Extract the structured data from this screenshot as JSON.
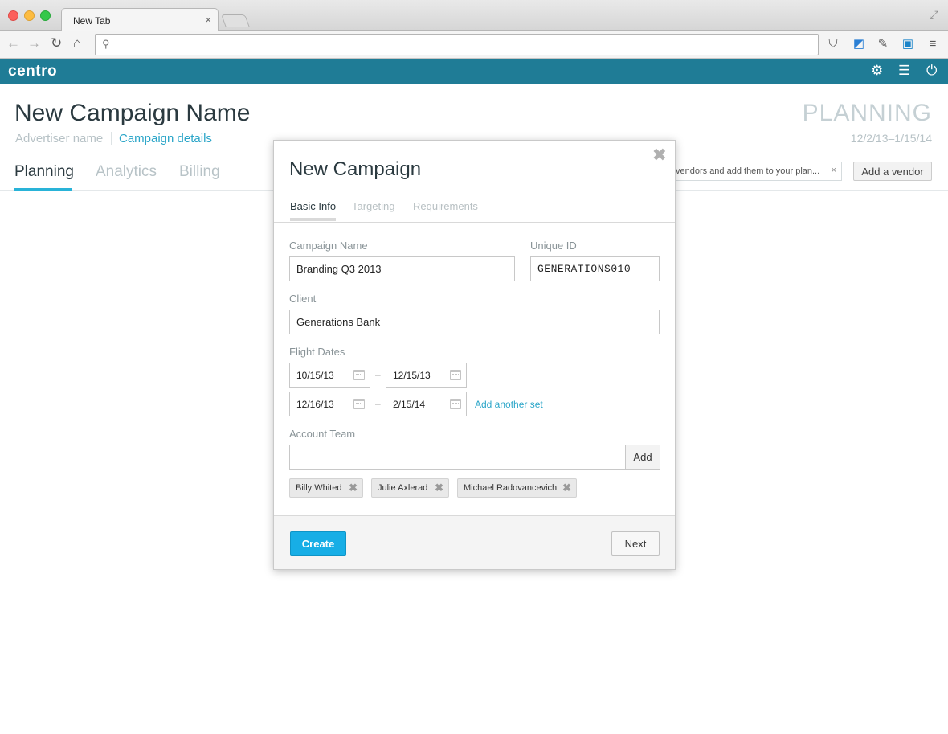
{
  "browser": {
    "tab_title": "New Tab",
    "tab_close": "×",
    "address_value": "",
    "icons": [
      "back-icon",
      "forward-icon",
      "reload-icon",
      "home-icon",
      "search-icon",
      "pocket-icon",
      "extension-icon",
      "pin-icon",
      "screenshot-icon",
      "menu-icon"
    ]
  },
  "app": {
    "logo": "centro",
    "brand_color": "#1f7c96",
    "icons": [
      "gear-icon",
      "list-icon",
      "power-icon"
    ]
  },
  "page": {
    "title": "New Campaign Name",
    "advertiser": "Advertiser name",
    "details_link": "Campaign details",
    "status": "PLANNING",
    "date_range": "12/2/13–1/15/14",
    "tabs": [
      {
        "label": "Planning",
        "active": true
      },
      {
        "label": "Analytics",
        "active": false
      },
      {
        "label": "Billing",
        "active": false
      }
    ],
    "tooltip": "vendors and add them to your plan...",
    "tooltip_close": "×",
    "add_vendor": "Add a vendor"
  },
  "modal": {
    "close": "✖",
    "title": "New Campaign",
    "tabs": [
      {
        "label": "Basic Info",
        "active": true
      },
      {
        "label": "Targeting",
        "active": false
      },
      {
        "label": "Requirements",
        "active": false
      }
    ],
    "campaign_name_label": "Campaign Name",
    "campaign_name_value": "Branding Q3 2013",
    "unique_id_label": "Unique ID",
    "unique_id_value": "GENERATIONS010",
    "client_label": "Client",
    "client_value": "Generations Bank",
    "flight_dates_label": "Flight Dates",
    "flight_dates": [
      {
        "start": "10/15/13",
        "end": "12/15/13"
      },
      {
        "start": "12/16/13",
        "end": "2/15/14"
      }
    ],
    "date_separator": "–",
    "add_another_set": "Add another set",
    "account_team_label": "Account Team",
    "account_team_value": "",
    "add_button": "Add",
    "team_members": [
      "Billy Whited",
      "Julie Axlerad",
      "Michael Radovancevich"
    ],
    "chip_remove": "✖",
    "create_button": "Create",
    "next_button": "Next",
    "primary_color": "#17aee6"
  }
}
